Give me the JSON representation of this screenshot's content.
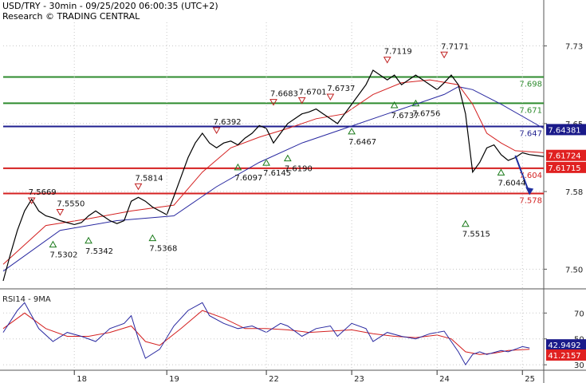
{
  "header": {
    "line1": "USD/TRY - 30min - 09/25/2020 06:00:35 (UTC+2)",
    "line2": "Research © TRADING CENTRAL"
  },
  "colors": {
    "green": "#2e8b2e",
    "navy": "#1f1f8f",
    "red": "#d42020",
    "price": "#000000",
    "ma_red": "#d42020",
    "ma_blue": "#2828a0",
    "grid": "#c8c8c8",
    "arrow": "#1f2f9f",
    "up_marker": "#1a7a1a",
    "down_marker": "#c02020",
    "badge_red": "#e02020",
    "badge_navy": "#1a1a8a"
  },
  "chart_data": [
    {
      "type": "line",
      "panel": "price",
      "y_ticks": [
        7.5,
        7.58,
        7.65,
        7.73
      ],
      "ylim": [
        7.4855,
        7.7543
      ],
      "x_ticks": [
        "18",
        "19",
        "22",
        "23",
        "24",
        "25"
      ],
      "grid": true,
      "series": [],
      "price_path": [
        [
          0,
          7.488
        ],
        [
          1,
          7.515
        ],
        [
          2,
          7.54
        ],
        [
          3,
          7.56
        ],
        [
          4,
          7.572
        ],
        [
          5,
          7.56
        ],
        [
          6,
          7.555
        ],
        [
          7,
          7.553
        ],
        [
          8,
          7.55
        ],
        [
          9,
          7.548
        ],
        [
          10,
          7.546
        ],
        [
          11,
          7.548
        ],
        [
          12,
          7.555
        ],
        [
          13,
          7.56
        ],
        [
          14,
          7.555
        ],
        [
          15,
          7.55
        ],
        [
          16,
          7.547
        ],
        [
          17,
          7.55
        ],
        [
          18,
          7.57
        ],
        [
          19,
          7.574
        ],
        [
          20,
          7.57
        ],
        [
          21,
          7.564
        ],
        [
          22,
          7.56
        ],
        [
          23,
          7.556
        ],
        [
          24,
          7.575
        ],
        [
          25,
          7.595
        ],
        [
          26,
          7.615
        ],
        [
          27,
          7.63
        ],
        [
          28,
          7.64
        ],
        [
          29,
          7.63
        ],
        [
          30,
          7.625
        ],
        [
          31,
          7.63
        ],
        [
          32,
          7.632
        ],
        [
          33,
          7.628
        ],
        [
          34,
          7.635
        ],
        [
          35,
          7.64
        ],
        [
          36,
          7.648
        ],
        [
          37,
          7.645
        ],
        [
          38,
          7.63
        ],
        [
          39,
          7.64
        ],
        [
          40,
          7.65
        ],
        [
          41,
          7.655
        ],
        [
          42,
          7.66
        ],
        [
          43,
          7.662
        ],
        [
          44,
          7.665
        ],
        [
          45,
          7.66
        ],
        [
          46,
          7.655
        ],
        [
          47,
          7.65
        ],
        [
          48,
          7.66
        ],
        [
          49,
          7.67
        ],
        [
          50,
          7.68
        ],
        [
          51,
          7.69
        ],
        [
          52,
          7.705
        ],
        [
          53,
          7.7
        ],
        [
          54,
          7.695
        ],
        [
          55,
          7.7
        ],
        [
          56,
          7.69
        ],
        [
          57,
          7.695
        ],
        [
          58,
          7.7
        ],
        [
          59,
          7.695
        ],
        [
          60,
          7.69
        ],
        [
          61,
          7.685
        ],
        [
          62,
          7.692
        ],
        [
          63,
          7.7
        ],
        [
          64,
          7.69
        ],
        [
          65,
          7.66
        ],
        [
          66,
          7.6
        ],
        [
          67,
          7.61
        ],
        [
          68,
          7.625
        ],
        [
          69,
          7.628
        ],
        [
          70,
          7.618
        ],
        [
          71,
          7.612
        ],
        [
          72,
          7.615
        ],
        [
          73,
          7.62
        ],
        [
          74,
          7.618
        ],
        [
          75,
          7.617
        ],
        [
          76,
          7.616
        ]
      ],
      "ma_red_path": [
        [
          0,
          7.505
        ],
        [
          6,
          7.545
        ],
        [
          12,
          7.552
        ],
        [
          18,
          7.56
        ],
        [
          24,
          7.566
        ],
        [
          28,
          7.6
        ],
        [
          32,
          7.625
        ],
        [
          36,
          7.636
        ],
        [
          40,
          7.645
        ],
        [
          44,
          7.655
        ],
        [
          48,
          7.66
        ],
        [
          52,
          7.68
        ],
        [
          56,
          7.692
        ],
        [
          60,
          7.695
        ],
        [
          64,
          7.69
        ],
        [
          66,
          7.67
        ],
        [
          68,
          7.64
        ],
        [
          70,
          7.63
        ],
        [
          72,
          7.622
        ],
        [
          76,
          7.62
        ]
      ],
      "ma_blue_path": [
        [
          0,
          7.498
        ],
        [
          8,
          7.54
        ],
        [
          16,
          7.55
        ],
        [
          24,
          7.555
        ],
        [
          30,
          7.585
        ],
        [
          36,
          7.61
        ],
        [
          42,
          7.63
        ],
        [
          48,
          7.645
        ],
        [
          54,
          7.66
        ],
        [
          58,
          7.67
        ],
        [
          62,
          7.68
        ],
        [
          64,
          7.688
        ],
        [
          66,
          7.685
        ],
        [
          70,
          7.67
        ],
        [
          76,
          7.645
        ]
      ],
      "levels": [
        {
          "value": 7.698,
          "label": "7.698",
          "color": "#2e8b2e"
        },
        {
          "value": 7.671,
          "label": "7.671",
          "color": "#2e8b2e"
        },
        {
          "value": 7.647,
          "label": "7.647",
          "color": "#1f1f8f"
        },
        {
          "value": 7.604,
          "label": "7.604",
          "color": "#d42020"
        },
        {
          "value": 7.578,
          "label": "7.578",
          "color": "#d42020"
        }
      ],
      "badges": [
        {
          "value": 7.64381,
          "label": "7.64381",
          "color": "#1a1a8a"
        },
        {
          "value": 7.61724,
          "label": "7.61724",
          "color": "#e02020"
        },
        {
          "value": 7.61715,
          "label": "7.61715",
          "color": "#e02020"
        }
      ],
      "annotations": [
        {
          "label": "7.5669",
          "x": 4,
          "y": 7.5669,
          "kind": "high"
        },
        {
          "label": "7.5550",
          "x": 8,
          "y": 7.555,
          "kind": "high"
        },
        {
          "label": "7.5302",
          "x": 7,
          "y": 7.5302,
          "kind": "low"
        },
        {
          "label": "7.5342",
          "x": 12,
          "y": 7.5342,
          "kind": "low"
        },
        {
          "label": "7.5814",
          "x": 19,
          "y": 7.5814,
          "kind": "high"
        },
        {
          "label": "7.5368",
          "x": 21,
          "y": 7.5368,
          "kind": "low"
        },
        {
          "label": "7.6392",
          "x": 30,
          "y": 7.6392,
          "kind": "high"
        },
        {
          "label": "7.6097",
          "x": 33,
          "y": 7.6097,
          "kind": "low"
        },
        {
          "label": "7.6145",
          "x": 37,
          "y": 7.6145,
          "kind": "low"
        },
        {
          "label": "7.6190",
          "x": 40,
          "y": 7.619,
          "kind": "low"
        },
        {
          "label": "7.6683",
          "x": 38,
          "y": 7.6683,
          "kind": "high"
        },
        {
          "label": "7.6701",
          "x": 42,
          "y": 7.6701,
          "kind": "high"
        },
        {
          "label": "7.6737",
          "x": 46,
          "y": 7.6737,
          "kind": "high"
        },
        {
          "label": "7.6467",
          "x": 49,
          "y": 7.6467,
          "kind": "low"
        },
        {
          "label": "7.7119",
          "x": 54,
          "y": 7.7119,
          "kind": "high"
        },
        {
          "label": "7.6737",
          "x": 55,
          "y": 7.6737,
          "kind": "low"
        },
        {
          "label": "7.6756",
          "x": 58,
          "y": 7.6756,
          "kind": "low"
        },
        {
          "label": "7.7171",
          "x": 62,
          "y": 7.7171,
          "kind": "high"
        },
        {
          "label": "7.5515",
          "x": 65,
          "y": 7.5515,
          "kind": "low"
        },
        {
          "label": "7.6044",
          "x": 70,
          "y": 7.6044,
          "kind": "low"
        }
      ],
      "projection": [
        [
          72,
          7.617
        ],
        [
          74,
          7.578
        ]
      ]
    },
    {
      "type": "line",
      "panel": "indicator",
      "title": "RSI14 - 9MA",
      "y_ticks": [
        30,
        50,
        70
      ],
      "ylim": [
        27,
        85
      ],
      "grid": true,
      "series": [],
      "rsi_path": [
        [
          0,
          55
        ],
        [
          2,
          72
        ],
        [
          3,
          78
        ],
        [
          5,
          58
        ],
        [
          7,
          48
        ],
        [
          9,
          55
        ],
        [
          11,
          52
        ],
        [
          13,
          48
        ],
        [
          15,
          58
        ],
        [
          17,
          62
        ],
        [
          18,
          68
        ],
        [
          19,
          50
        ],
        [
          20,
          35
        ],
        [
          22,
          42
        ],
        [
          24,
          60
        ],
        [
          26,
          72
        ],
        [
          28,
          78
        ],
        [
          29,
          68
        ],
        [
          31,
          62
        ],
        [
          33,
          58
        ],
        [
          35,
          60
        ],
        [
          37,
          55
        ],
        [
          39,
          62
        ],
        [
          40,
          60
        ],
        [
          42,
          52
        ],
        [
          44,
          58
        ],
        [
          46,
          60
        ],
        [
          47,
          52
        ],
        [
          49,
          62
        ],
        [
          51,
          58
        ],
        [
          52,
          48
        ],
        [
          54,
          55
        ],
        [
          56,
          52
        ],
        [
          58,
          50
        ],
        [
          60,
          54
        ],
        [
          62,
          56
        ],
        [
          63,
          48
        ],
        [
          64,
          40
        ],
        [
          65,
          30
        ],
        [
          66,
          38
        ],
        [
          67,
          40
        ],
        [
          68,
          38
        ],
        [
          70,
          41
        ],
        [
          71,
          40
        ],
        [
          72,
          42
        ],
        [
          73,
          44
        ],
        [
          74,
          43
        ]
      ],
      "ma_path": [
        [
          0,
          58
        ],
        [
          3,
          70
        ],
        [
          6,
          58
        ],
        [
          9,
          52
        ],
        [
          12,
          52
        ],
        [
          15,
          55
        ],
        [
          18,
          60
        ],
        [
          20,
          48
        ],
        [
          22,
          45
        ],
        [
          25,
          58
        ],
        [
          28,
          72
        ],
        [
          31,
          66
        ],
        [
          34,
          58
        ],
        [
          37,
          58
        ],
        [
          40,
          57
        ],
        [
          43,
          55
        ],
        [
          46,
          56
        ],
        [
          49,
          57
        ],
        [
          52,
          54
        ],
        [
          55,
          52
        ],
        [
          58,
          51
        ],
        [
          61,
          53
        ],
        [
          63,
          50
        ],
        [
          65,
          40
        ],
        [
          67,
          38
        ],
        [
          69,
          39
        ],
        [
          71,
          41
        ],
        [
          74,
          42
        ]
      ],
      "badges": [
        {
          "value": 42.9492,
          "label": "42.9492",
          "color": "#1a1a8a"
        },
        {
          "value": 41.2157,
          "label": "41.2157",
          "color": "#e02020"
        }
      ]
    }
  ]
}
